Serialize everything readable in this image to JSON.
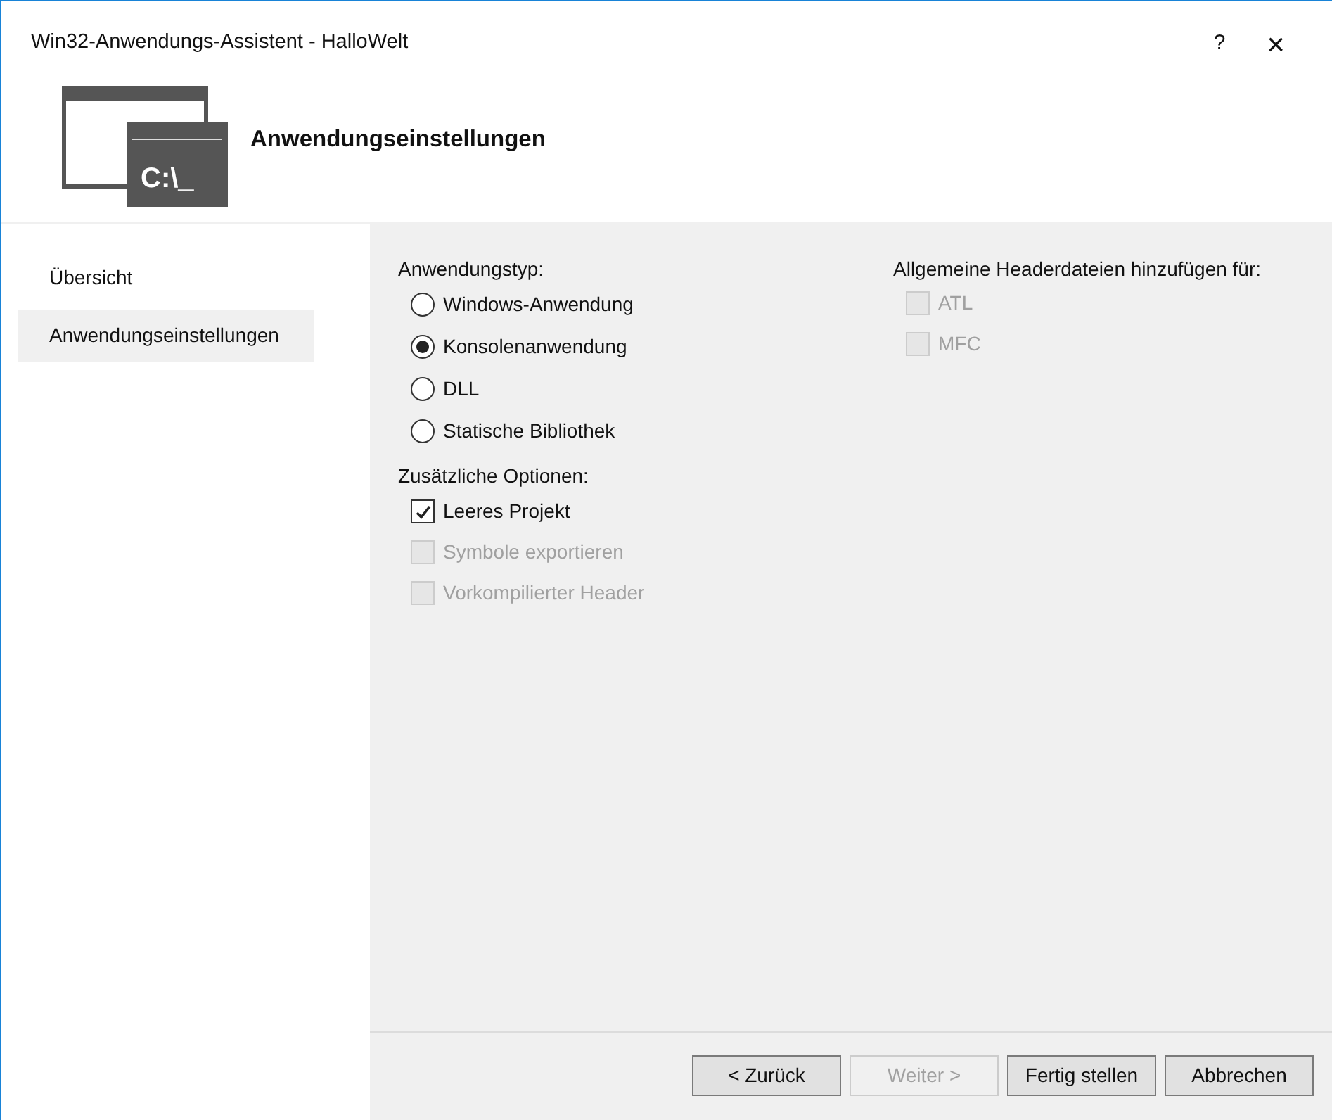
{
  "window": {
    "title": "Win32-Anwendungs-Assistent - HalloWelt",
    "help": "?",
    "close": "×"
  },
  "header": {
    "icon_label": "C:\\_",
    "title": "Anwendungseinstellungen"
  },
  "sidebar": {
    "items": [
      {
        "label": "Übersicht",
        "selected": false
      },
      {
        "label": "Anwendungseinstellungen",
        "selected": true
      }
    ]
  },
  "app_type": {
    "label": "Anwendungstyp:",
    "options": [
      {
        "label": "Windows-Anwendung",
        "selected": false
      },
      {
        "label": "Konsolenanwendung",
        "selected": true
      },
      {
        "label": "DLL",
        "selected": false
      },
      {
        "label": "Statische Bibliothek",
        "selected": false
      }
    ]
  },
  "extra_options": {
    "label": "Zusätzliche Optionen:",
    "items": [
      {
        "label": "Leeres Projekt",
        "checked": true,
        "disabled": false
      },
      {
        "label": "Symbole exportieren",
        "checked": false,
        "disabled": true
      },
      {
        "label": "Vorkompilierter Header",
        "checked": false,
        "disabled": true
      }
    ]
  },
  "headers": {
    "label": "Allgemeine Headerdateien hinzufügen für:",
    "items": [
      {
        "label": "ATL",
        "checked": false,
        "disabled": true
      },
      {
        "label": "MFC",
        "checked": false,
        "disabled": true
      }
    ]
  },
  "buttons": [
    {
      "label": "< Zurück",
      "disabled": false
    },
    {
      "label": "Weiter >",
      "disabled": true
    },
    {
      "label": "Fertig stellen",
      "disabled": false
    },
    {
      "label": "Abbrechen",
      "disabled": false
    }
  ]
}
